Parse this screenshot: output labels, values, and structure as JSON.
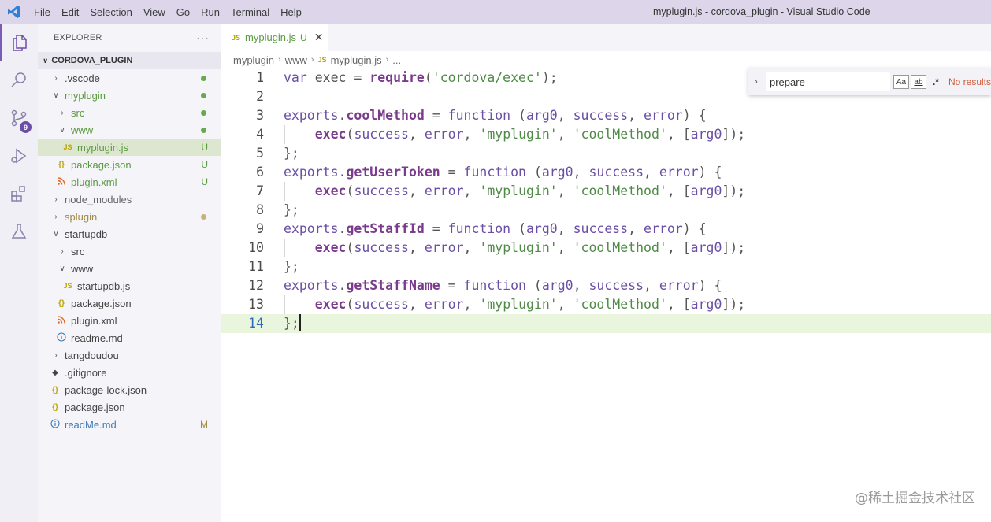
{
  "window": {
    "title": "myplugin.js - cordova_plugin - Visual Studio Code",
    "menu": [
      "File",
      "Edit",
      "Selection",
      "View",
      "Go",
      "Run",
      "Terminal",
      "Help"
    ]
  },
  "activity_bar": {
    "scm_badge": "9"
  },
  "sidebar": {
    "header": "EXPLORER",
    "more": "···",
    "root": "CORDOVA_PLUGIN",
    "rows": [
      {
        "label": ".vscode",
        "status": ""
      },
      {
        "label": "myplugin",
        "status": ""
      },
      {
        "label": "src",
        "status": ""
      },
      {
        "label": "www",
        "status": ""
      },
      {
        "label": "myplugin.js",
        "icon": "JS",
        "status": "U"
      },
      {
        "label": "package.json",
        "icon": "{}",
        "status": "U"
      },
      {
        "label": "plugin.xml",
        "icon": "rss",
        "status": "U"
      },
      {
        "label": "node_modules",
        "status": ""
      },
      {
        "label": "splugin",
        "status": ""
      },
      {
        "label": "startupdb",
        "status": ""
      },
      {
        "label": "src",
        "status": ""
      },
      {
        "label": "www",
        "status": ""
      },
      {
        "label": "startupdb.js",
        "icon": "JS",
        "status": ""
      },
      {
        "label": "package.json",
        "icon": "{}",
        "status": ""
      },
      {
        "label": "plugin.xml",
        "icon": "rss",
        "status": ""
      },
      {
        "label": "readme.md",
        "icon": "i",
        "status": ""
      },
      {
        "label": "tangdoudou",
        "status": ""
      },
      {
        "label": ".gitignore",
        "icon": "git",
        "status": ""
      },
      {
        "label": "package-lock.json",
        "icon": "{}",
        "status": ""
      },
      {
        "label": "package.json",
        "icon": "{}",
        "status": ""
      },
      {
        "label": "readMe.md",
        "icon": "i",
        "status": "M"
      }
    ]
  },
  "tab": {
    "icon": "JS",
    "name": "myplugin.js",
    "status": "U",
    "close": "✕"
  },
  "breadcrumb": {
    "parts": [
      "myplugin",
      "www",
      "myplugin.js",
      "..."
    ],
    "js_icon": "JS"
  },
  "editor": {
    "line_numbers": [
      "1",
      "2",
      "3",
      "4",
      "5",
      "6",
      "7",
      "8",
      "9",
      "10",
      "11",
      "12",
      "13",
      "14"
    ],
    "lines": [
      "var exec = require('cordova/exec');",
      "",
      "exports.coolMethod = function (arg0, success, error) {",
      "    exec(success, error, 'myplugin', 'coolMethod', [arg0]);",
      "};",
      "exports.getUserToken = function (arg0, success, error) {",
      "    exec(success, error, 'myplugin', 'coolMethod', [arg0]);",
      "};",
      "exports.getStaffId = function (arg0, success, error) {",
      "    exec(success, error, 'myplugin', 'coolMethod', [arg0]);",
      "};",
      "exports.getStaffName = function (arg0, success, error) {",
      "    exec(success, error, 'myplugin', 'coolMethod', [arg0]);",
      "};"
    ],
    "current_line": 14
  },
  "find": {
    "toggle": "›",
    "value": "prepare",
    "match_case": "Aa",
    "whole_word": "ab",
    "regex": ".*",
    "result": "No results"
  },
  "watermark": "@稀土掘金技术社区",
  "colors": {
    "titlebar": "#ddd6ea",
    "accent": "#6a4fa5",
    "untracked": "#5a9a40",
    "modified": "#a08a45",
    "no_results": "#d05a3a"
  }
}
